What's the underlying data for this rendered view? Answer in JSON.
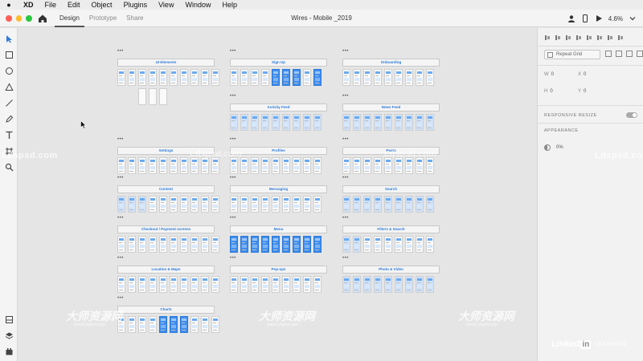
{
  "menubar": {
    "items": [
      "XD",
      "File",
      "Edit",
      "Object",
      "Plugins",
      "View",
      "Window",
      "Help"
    ]
  },
  "titlebar": {
    "tabs": [
      "Design",
      "Prototype",
      "Share"
    ],
    "active_tab": "Design",
    "doc_title": "Wires - Mobile _2019",
    "zoom": "4.6%"
  },
  "canvas": {
    "groups": [
      {
        "label": "UI Elements",
        "artboards": 10
      },
      {
        "label": "Sign Up",
        "artboards": 9
      },
      {
        "label": "Onboarding",
        "artboards": 9
      },
      {
        "label": "Activity Feed",
        "artboards": 9
      },
      {
        "label": "News Feed",
        "artboards": 9
      },
      {
        "label": "Settings",
        "artboards": 10
      },
      {
        "label": "Profiles",
        "artboards": 9
      },
      {
        "label": "Posts",
        "artboards": 9
      },
      {
        "label": "Content",
        "artboards": 10
      },
      {
        "label": "Messaging",
        "artboards": 9
      },
      {
        "label": "Search",
        "artboards": 9
      },
      {
        "label": "Checkout / Payment screens",
        "artboards": 10
      },
      {
        "label": "Menu",
        "artboards": 9
      },
      {
        "label": "Filters & Search",
        "artboards": 9
      },
      {
        "label": "Location & Maps",
        "artboards": 10
      },
      {
        "label": "Pop-ups",
        "artboards": 9
      },
      {
        "label": "Photo & Video",
        "artboards": 9
      },
      {
        "label": "Charts",
        "artboards": 10
      }
    ],
    "group_marker": "•••"
  },
  "right_panel": {
    "repeat_grid_label": "Repeat Grid",
    "w_label": "W",
    "w_value": "0",
    "h_label": "H",
    "h_value": "0",
    "x_label": "X",
    "x_value": "0",
    "y_label": "Y",
    "y_value": "0",
    "responsive_resize_label": "RESPONSIVE RESIZE",
    "appearance_label": "APPEARANCE",
    "opacity_value": "0%"
  },
  "watermarks": {
    "site": "Ldspsd.com",
    "cn": "大师资源网",
    "cn_sub": "www.Ldspsd.com"
  },
  "brand": {
    "linkedin": "Linked",
    "in": "in",
    "learning": "LEARNING"
  },
  "colors": {
    "accent": "#2e7bd8",
    "artboard_blue": "#3e8ef0",
    "canvas": "#e5e5e5"
  }
}
